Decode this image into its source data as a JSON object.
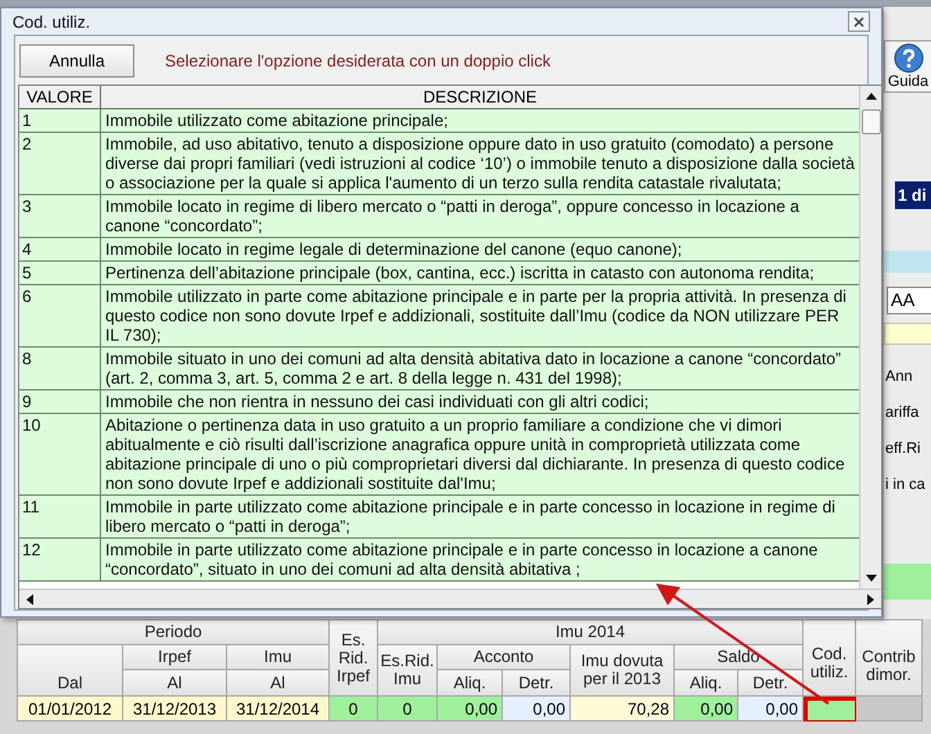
{
  "dialog": {
    "title": "Cod. utiliz.",
    "cancel_button": "Annulla",
    "instruction": "Selezionare l'opzione desiderata con un doppio click",
    "columns": [
      "VALORE",
      "DESCRIZIONE"
    ],
    "rows": [
      {
        "value": "1",
        "description": "Immobile utilizzato come abitazione principale;"
      },
      {
        "value": "2",
        "description": "Immobile, ad uso abitativo, tenuto a disposizione oppure dato in uso gratuito (comodato) a persone diverse dai propri familiari (vedi istruzioni al codice ‘10’) o immobile tenuto a disposizione dalla società o associazione per la quale si applica l'aumento di un terzo sulla rendita catastale rivalutata;"
      },
      {
        "value": "3",
        "description": "Immobile locato in regime di libero mercato o “patti in deroga”, oppure concesso in locazione a canone “concordato”;"
      },
      {
        "value": "4",
        "description": "Immobile locato in regime legale di determinazione del canone (equo canone);"
      },
      {
        "value": "5",
        "description": "Pertinenza dell’abitazione principale (box, cantina, ecc.) iscritta in catasto con autonoma rendita;"
      },
      {
        "value": "6",
        "description": "Immobile utilizzato in parte come abitazione principale e in parte per la propria attività. In presenza di questo codice non sono dovute Irpef e addizionali, sostituite dall’Imu (codice da NON utilizzare PER IL 730);"
      },
      {
        "value": "8",
        "description": "Immobile situato in uno dei comuni ad alta densità abitativa dato in locazione a canone “concordato” (art. 2, comma 3, art. 5, comma 2 e art. 8 della legge n. 431 del 1998);"
      },
      {
        "value": "9",
        "description": "Immobile che non rientra in nessuno dei casi individuati con gli altri codici;"
      },
      {
        "value": "10",
        "description": "Abitazione o pertinenza data in uso gratuito a un proprio familiare a condizione che vi dimori abitualmente e ciò risulti dall’iscrizione anagrafica oppure unità in comproprietà utilizzata come abitazione principale di uno o più comproprietari diversi dal dichiarante. In presenza di questo codice non sono dovute Irpef e addizionali sostituite dal'Imu;"
      },
      {
        "value": "11",
        "description": "Immobile in parte utilizzato come abitazione principale e in parte concesso in locazione in regime di libero mercato o “patti in deroga”;"
      },
      {
        "value": "12",
        "description": "Immobile in parte utilizzato come abitazione principale e in parte concesso in locazione a canone “concordato”, situato in uno dei comuni ad alta densità abitativa ;"
      }
    ]
  },
  "side_panel": {
    "help_button": "Guida",
    "page_indicator": "1 di",
    "field_value": "AA",
    "labels": [
      "Ann",
      "ariffa",
      "eff.Ri",
      "i in ca"
    ]
  },
  "bottom_table": {
    "header": {
      "periodo": "Periodo",
      "irpef": "Irpef",
      "imu": "Imu",
      "dal": "Dal",
      "al_irpef": "Al",
      "al_imu": "Al",
      "es_rid_irpef": "Es. Rid. Irpef",
      "imu_2014": "Imu 2014",
      "es_rid_imu": "Es.Rid. Imu",
      "acconto": "Acconto",
      "acconto_aliq": "Aliq.",
      "acconto_detr": "Detr.",
      "imu_dovuta": "Imu dovuta per il 2013",
      "saldo": "Saldo",
      "saldo_aliq": "Aliq.",
      "saldo_detr": "Detr.",
      "cod_utiliz": "Cod. utiliz.",
      "contrib_dimor": "Contrib dimor."
    },
    "row": {
      "dal": "01/01/2012",
      "al_irpef": "31/12/2013",
      "al_imu": "31/12/2014",
      "es_rid_irpef": "0",
      "es_rid_imu": "0",
      "acconto_aliq": "0,00",
      "acconto_detr": "0,00",
      "imu_dovuta": "70,28",
      "saldo_aliq": "0,00",
      "saldo_detr": "0,00",
      "cod_utiliz_highlighted": true
    }
  }
}
